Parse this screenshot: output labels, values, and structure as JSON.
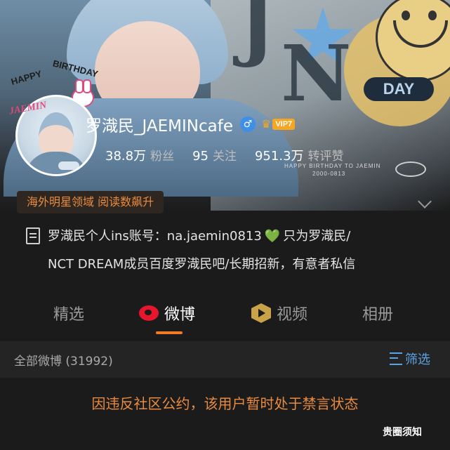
{
  "banner": {
    "day_label": "DAY",
    "caption_line1": "HAPPY BIRTHDAY TO JAEMIN",
    "caption_line2": "2000-0813"
  },
  "avatar": {
    "arc_word1": "HAPPY",
    "arc_word2": "BIRTHDAY",
    "script_name": "JAEMIN"
  },
  "profile": {
    "username": "罗渽民_JAEMINcafe",
    "gender_icon": "male-icon",
    "vip_label": "VIP7",
    "stats": [
      {
        "value": "38.8万",
        "label": "粉丝"
      },
      {
        "value": "95",
        "label": "关注"
      },
      {
        "value": "951.3万",
        "label": "转评赞"
      }
    ],
    "promo_tag": "海外明星领域 阅读数飙升",
    "bio_line1_a": "罗渽民个人ins账号：na.jaemin0813",
    "bio_heart": "💚",
    "bio_line1_b": "只为罗渽民/",
    "bio_line2": "NCT DREAM成员百度罗渽民吧/长期招新，有意者私信"
  },
  "tabs": [
    {
      "label": "精选",
      "active": false
    },
    {
      "label": "微博",
      "active": true
    },
    {
      "label": "视频",
      "active": false
    },
    {
      "label": "相册",
      "active": false
    }
  ],
  "filter": {
    "count_label": "全部微博 (31992)",
    "filter_label": "筛选"
  },
  "notice": "因违反社区公约，该用户暂时处于禁言状态",
  "watermark": "贵圈须知",
  "colors": {
    "accent_orange": "#f07b24",
    "link_blue": "#5aa3e6",
    "weibo_red": "#e6162d",
    "vip_gold": "#f5a623"
  }
}
